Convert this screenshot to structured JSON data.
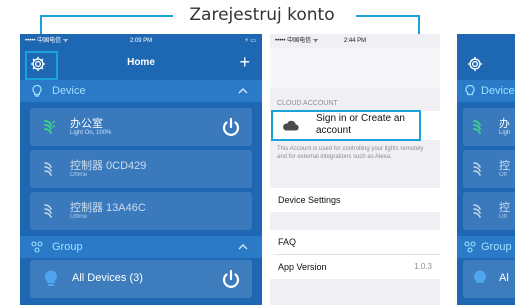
{
  "callout": {
    "label": "Zarejestruj konto",
    "accent_color": "#1aa3d9"
  },
  "phone_home": {
    "status": {
      "carrier": "••••• 中国电信 ᯤ",
      "time": "2:09 PM",
      "battery": "⚡ ▭"
    },
    "nav": {
      "title": "Home",
      "settings_icon": "gear-icon",
      "add_label": "+"
    },
    "device_section": {
      "label": "Device"
    },
    "devices": [
      {
        "name": "办公室",
        "status": "Light On, 100%"
      },
      {
        "name": "控制器 0CD429",
        "status": "Offline"
      },
      {
        "name": "控制器 13A46C",
        "status": "Offline"
      }
    ],
    "group_section": {
      "label": "Group"
    },
    "groups": [
      {
        "name": "All Devices (3)"
      }
    ],
    "colors": {
      "background": "#1e67b3",
      "section_header": "#2a7ac7",
      "section_text": "#9fe0ff",
      "lamp_on": "#3dd68c"
    }
  },
  "phone_settings": {
    "status": {
      "carrier": "••••• 中国电信 ᯤ",
      "time": "2:44 PM"
    },
    "cloud_account_header": "CLOUD ACCOUNT",
    "sign_in_label": "Sign in or Create an account",
    "description": "This Account is used for controlling your lights remotely and for external integrations such as Alexa.",
    "device_settings_label": "Device Settings",
    "faq_label": "FAQ",
    "app_version_label": "App Version",
    "app_version_value": "1.0.3"
  },
  "phone_partial": {
    "device_section": {
      "label": "Device"
    },
    "devices": [
      {
        "name": "办",
        "status": "Ligh"
      },
      {
        "name": "控",
        "status": "Off"
      },
      {
        "name": "控",
        "status": "Off"
      }
    ],
    "group_section": {
      "label": "Group"
    },
    "groups": [
      {
        "name": "Al"
      }
    ]
  }
}
